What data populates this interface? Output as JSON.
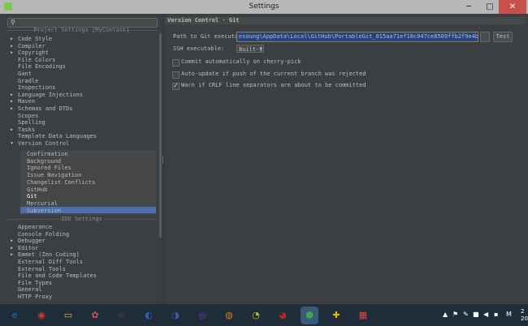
{
  "window": {
    "title": "Settings",
    "min": "─",
    "max": "□",
    "close": "✕"
  },
  "search": {
    "value": ""
  },
  "sections": {
    "project": "Project Settings [MyContact]",
    "ide": "IDE Settings"
  },
  "tree": {
    "project_items": [
      {
        "label": "Code Style",
        "arrow": "▶"
      },
      {
        "label": "Compiler",
        "arrow": "▶"
      },
      {
        "label": "Copyright",
        "arrow": "▶"
      },
      {
        "label": "File Colors",
        "arrow": ""
      },
      {
        "label": "File Encodings",
        "arrow": ""
      },
      {
        "label": "Gant",
        "arrow": ""
      },
      {
        "label": "Gradle",
        "arrow": ""
      },
      {
        "label": "Inspections",
        "arrow": ""
      },
      {
        "label": "Language Injections",
        "arrow": "▶"
      },
      {
        "label": "Maven",
        "arrow": "▶"
      },
      {
        "label": "Schemas and DTDs",
        "arrow": "▶"
      },
      {
        "label": "Scopes",
        "arrow": ""
      },
      {
        "label": "Spelling",
        "arrow": ""
      },
      {
        "label": "Tasks",
        "arrow": "▶"
      },
      {
        "label": "Template Data Languages",
        "arrow": ""
      },
      {
        "label": "Version Control",
        "arrow": "▼"
      }
    ],
    "vcs_children": [
      "Confirmation",
      "Background",
      "Ignored Files",
      "Issue Navigation",
      "Changelist Conflicts",
      "GitHub",
      "Git",
      "Mercurial",
      "Subversion"
    ],
    "ide_items": [
      {
        "label": "Appearance",
        "arrow": ""
      },
      {
        "label": "Console Folding",
        "arrow": ""
      },
      {
        "label": "Debugger",
        "arrow": "▶"
      },
      {
        "label": "Editor",
        "arrow": "▶"
      },
      {
        "label": "Emmet (Zen Coding)",
        "arrow": "▶"
      },
      {
        "label": "External Diff Tools",
        "arrow": ""
      },
      {
        "label": "External Tools",
        "arrow": ""
      },
      {
        "label": "File and Code Templates",
        "arrow": ""
      },
      {
        "label": "File Types",
        "arrow": ""
      },
      {
        "label": "General",
        "arrow": ""
      },
      {
        "label": "HTTP Proxy",
        "arrow": ""
      }
    ]
  },
  "panel": {
    "header": "Version Control · Git",
    "path_label": "Path to Git executable:",
    "path_value": "esoung\\AppData\\Local\\GitHub\\PortableGit_015aa71ef18c047ce8509ffb2f9e4bb0e3e73f13\\bin\\git.exe",
    "browse_label": "",
    "test_label": "Test",
    "ssh_label": "SSH executable:",
    "ssh_value": "Built-in",
    "chk1_label": "Commit automatically on cherry-pick",
    "chk1_checked": false,
    "chk2_label": "Auto-update if push of the current branch was rejected",
    "chk2_checked": false,
    "chk3_label": "Warn if CRLF line separators are about to be committed",
    "chk3_checked": true
  },
  "taskbar": {
    "icons": [
      "ie-icon",
      "chrome-icon",
      "explorer-icon",
      "app-icon-1",
      "qq-icon",
      "app-icon-2",
      "app-icon-3",
      "app-icon-4",
      "app-icon-5",
      "app-icon-6",
      "app-icon-7",
      "android-studio-icon",
      "app-icon-8",
      "app-icon-9"
    ],
    "tray_lang": "M",
    "clock": "2\n20"
  },
  "colors": {
    "selection": "#4b6eaf",
    "background": "#3c3f41",
    "text": "#bbbbbb"
  }
}
